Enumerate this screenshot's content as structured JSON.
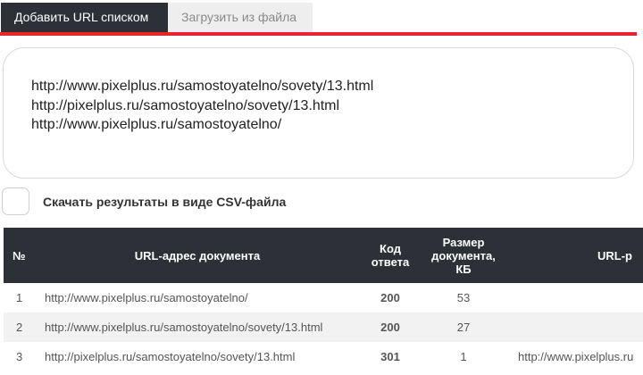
{
  "tabs": [
    {
      "label": "Добавить URL списком",
      "active": true
    },
    {
      "label": "Загрузить из файла",
      "active": false
    }
  ],
  "url_input": {
    "lines": [
      "http://www.pixelplus.ru/samostoyatelno/sovety/13.html",
      "http://pixelplus.ru/samostoyatelno/sovety/13.html",
      "http://www.pixelplus.ru/samostoyatelno/"
    ]
  },
  "csv_option": {
    "label": "Скачать результаты в виде CSV-файла",
    "checked": false
  },
  "table": {
    "headers": {
      "num": "№",
      "url": "URL-адрес документа",
      "code": [
        "Код",
        "ответа"
      ],
      "size": [
        "Размер",
        "документа,",
        "КБ"
      ],
      "redirect": "URL-р"
    },
    "rows": [
      {
        "num": "1",
        "url": "http://www.pixelplus.ru/samostoyatelno/",
        "code": "200",
        "size": "53",
        "redirect": ""
      },
      {
        "num": "2",
        "url": "http://www.pixelplus.ru/samostoyatelno/sovety/13.html",
        "code": "200",
        "size": "27",
        "redirect": ""
      },
      {
        "num": "3",
        "url": "http://pixelplus.ru/samostoyatelno/sovety/13.html",
        "code": "301",
        "size": "1",
        "redirect": "http://www.pixelplus.ru"
      }
    ]
  },
  "colors": {
    "header_bg": "#2d3037",
    "accent_red": "#e0292f",
    "code_ok": "#1a7a1a",
    "code_redirect": "#e08a00"
  }
}
